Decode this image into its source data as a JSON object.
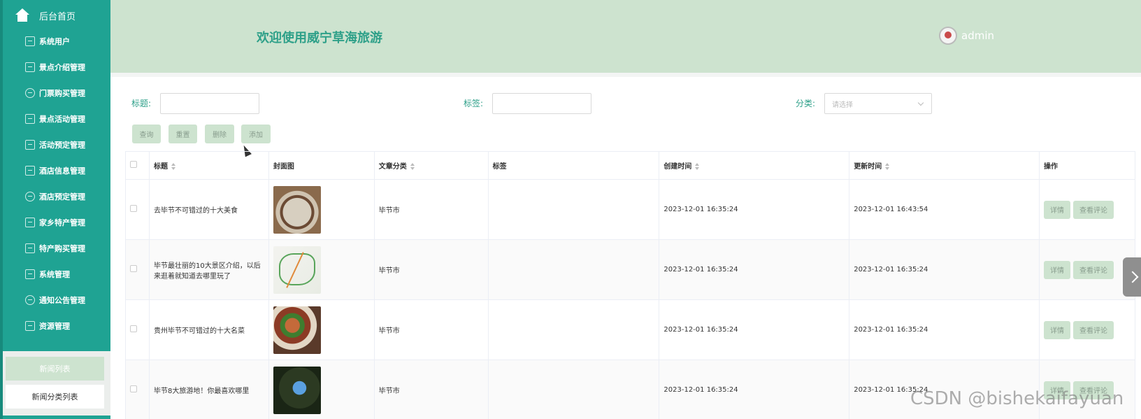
{
  "sidebar": {
    "home_label": "后台首页",
    "items": [
      {
        "label": "系统用户",
        "icon": "user-card-icon"
      },
      {
        "label": "景点介绍管理",
        "icon": "chart-icon"
      },
      {
        "label": "门票购买管理",
        "icon": "cloud-icon"
      },
      {
        "label": "景点活动管理",
        "icon": "edit-icon"
      },
      {
        "label": "活动预定管理",
        "icon": "chart-icon"
      },
      {
        "label": "酒店信息管理",
        "icon": "edit-icon"
      },
      {
        "label": "酒店预定管理",
        "icon": "cloud-icon"
      },
      {
        "label": "家乡特产管理",
        "icon": "chart-icon"
      },
      {
        "label": "特产购买管理",
        "icon": "user-card-icon"
      },
      {
        "label": "系统管理",
        "icon": "edit-icon"
      },
      {
        "label": "通知公告管理",
        "icon": "cloud-icon"
      },
      {
        "label": "资源管理",
        "icon": "edit-icon"
      }
    ],
    "sub_items": [
      "新闻列表",
      "新闻分类列表"
    ]
  },
  "header": {
    "title": "欢迎使用威宁草海旅游",
    "username": "admin"
  },
  "search": {
    "title_label": "标题:",
    "tag_label": "标签:",
    "category_label": "分类:",
    "category_placeholder": "请选择"
  },
  "toolbar": {
    "query": "查询",
    "reset": "重置",
    "delete": "删除",
    "add": "添加"
  },
  "table": {
    "columns": [
      "标题",
      "封面图",
      "文章分类",
      "标签",
      "创建时间",
      "更新时间",
      "操作"
    ],
    "rows": [
      {
        "title": "去毕节不可错过的十大美食",
        "category": "毕节市",
        "tag": "",
        "created": "2023-12-01 16:35:24",
        "updated": "2023-12-01 16:43:54"
      },
      {
        "title": "毕节最壮丽的10大景区介绍，以后来逛着就知道去哪里玩了",
        "category": "毕节市",
        "tag": "",
        "created": "2023-12-01 16:35:24",
        "updated": "2023-12-01 16:35:24"
      },
      {
        "title": "贵州毕节不可错过的十大名菜",
        "category": "毕节市",
        "tag": "",
        "created": "2023-12-01 16:35:24",
        "updated": "2023-12-01 16:35:24"
      },
      {
        "title": "毕节8大旅游地！你最喜欢哪里",
        "category": "毕节市",
        "tag": "",
        "created": "2023-12-01 16:35:24",
        "updated": "2023-12-01 16:35:24"
      }
    ],
    "detail_label": "详情",
    "comment_label": "查看评论"
  },
  "watermark": "CSDN @bishekaifayuan",
  "colors": {
    "sidebar": "#1fa393",
    "header": "#cde3cf",
    "accent_text": "#2ea089"
  }
}
